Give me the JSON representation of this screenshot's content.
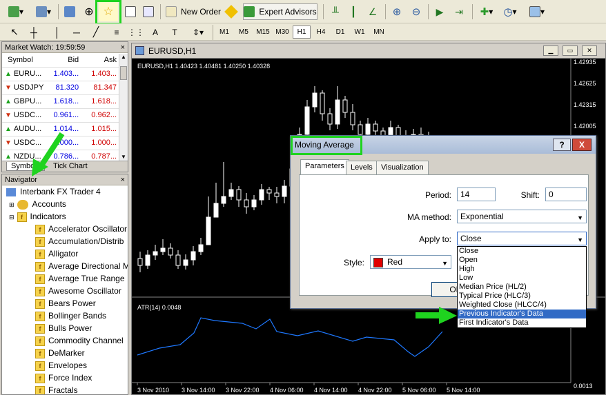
{
  "toolbar": {
    "new_order": "New Order",
    "expert_advisors": "Expert Advisors",
    "timeframes": [
      "M1",
      "M5",
      "M15",
      "M30",
      "H1",
      "H4",
      "D1",
      "W1",
      "MN"
    ],
    "active_timeframe": "H1",
    "icons": [
      "new-chart-icon",
      "profiles-icon",
      "market-watch-icon",
      "crosshair-icon",
      "favorites-icon",
      "navigator-icon",
      "zoom-icon",
      "new-order-icon",
      "expert-advisors-icon",
      "chart-bar-icon",
      "candlestick-icon",
      "line-chart-icon",
      "zoom-in-icon",
      "zoom-out-icon",
      "autoscroll-icon",
      "chart-shift-icon",
      "indicators-icon",
      "periods-icon",
      "templates-icon"
    ]
  },
  "market_watch": {
    "title": "Market Watch: 19:59:59",
    "columns": [
      "Symbol",
      "Bid",
      "Ask"
    ],
    "rows": [
      {
        "symbol": "EURU...",
        "bid": "1.403...",
        "ask": "1.403...",
        "dir": "up"
      },
      {
        "symbol": "USDJPY",
        "bid": "81.320",
        "ask": "81.347",
        "dir": "down"
      },
      {
        "symbol": "GBPU...",
        "bid": "1.618...",
        "ask": "1.618...",
        "dir": "up"
      },
      {
        "symbol": "USDC...",
        "bid": "0.961...",
        "ask": "0.962...",
        "dir": "down"
      },
      {
        "symbol": "AUDU...",
        "bid": "1.014...",
        "ask": "1.015...",
        "dir": "up"
      },
      {
        "symbol": "USDC...",
        "bid": "1.000...",
        "ask": "1.000...",
        "dir": "down"
      },
      {
        "symbol": "NZDU...",
        "bid": "0.786...",
        "ask": "0.787...",
        "dir": "up"
      }
    ],
    "tabs": [
      "Symbols",
      "Tick Chart"
    ]
  },
  "navigator": {
    "title": "Navigator",
    "root": "Interbank FX Trader 4",
    "accounts": "Accounts",
    "indicators": "Indicators",
    "items": [
      "Accelerator Oscillator",
      "Accumulation/Distrib",
      "Alligator",
      "Average Directional M",
      "Average True Range",
      "Awesome Oscillator",
      "Bears Power",
      "Bollinger Bands",
      "Bulls Power",
      "Commodity Channel",
      "DeMarker",
      "Envelopes",
      "Force Index",
      "Fractals"
    ]
  },
  "chart": {
    "window_title": "EURUSD,H1",
    "info": "EURUSD,H1  1.40423 1.40481 1.40250 1.40328",
    "price_labels": [
      "1.42935",
      "1.42625",
      "1.42315",
      "1.42005"
    ],
    "atr_label": "ATR(14) 0.0048",
    "atr_axis": "0.0013",
    "time_labels": [
      "3 Nov 2010",
      "3 Nov 14:00",
      "3 Nov 22:00",
      "4 Nov 06:00",
      "4 Nov 14:00",
      "4 Nov 22:00",
      "5 Nov 06:00",
      "5 Nov 14:00"
    ]
  },
  "dialog": {
    "title": "Moving Average",
    "help": "?",
    "close": "X",
    "tabs": [
      "Parameters",
      "Levels",
      "Visualization"
    ],
    "period_label": "Period:",
    "period_value": "14",
    "shift_label": "Shift:",
    "shift_value": "0",
    "method_label": "MA method:",
    "method_value": "Exponential",
    "apply_label": "Apply to:",
    "apply_value": "Close",
    "style_label": "Style:",
    "style_value": "Red",
    "style_color": "#e00000",
    "ok": "OK",
    "apply_options": [
      "Close",
      "Open",
      "High",
      "Low",
      "Median Price (HL/2)",
      "Typical Price (HLC/3)",
      "Weighted Close (HLCC/4)",
      "Previous Indicator's Data",
      "First Indicator's Data"
    ],
    "selected_option": "Previous Indicator's Data"
  },
  "colors": {
    "highlight": "#1fd31f",
    "up": "#1aa31a",
    "down": "#d03010",
    "bid_blue": "#0000e0",
    "ask_red": "#d00000",
    "chart_line": "#1e78ff"
  }
}
